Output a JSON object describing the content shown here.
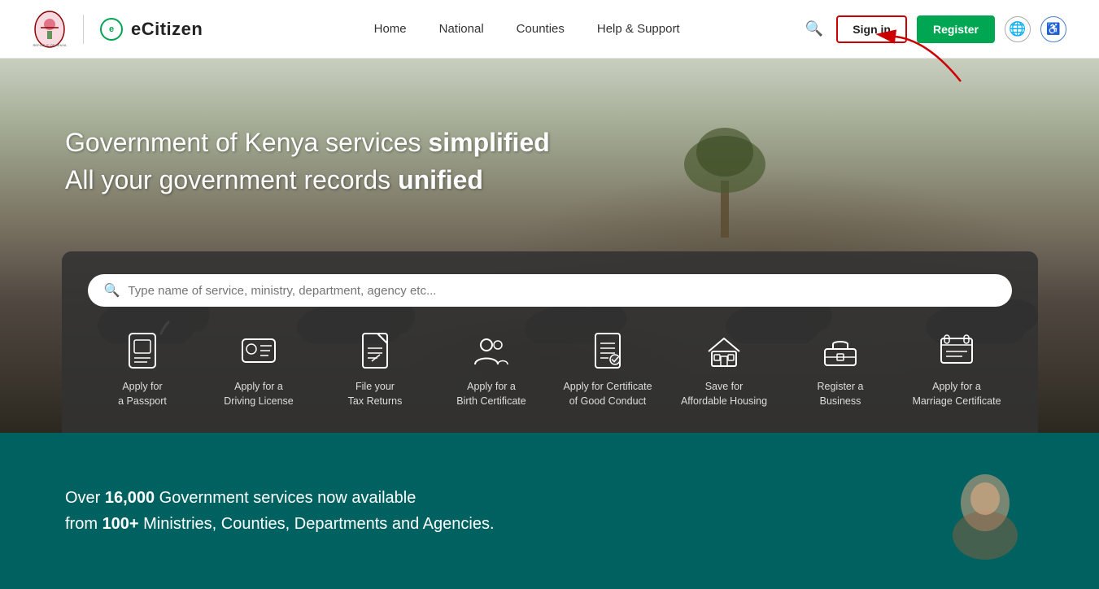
{
  "navbar": {
    "logo_text": "eCitizen",
    "nav_links": [
      {
        "label": "Home",
        "id": "nav-home"
      },
      {
        "label": "National",
        "id": "nav-national"
      },
      {
        "label": "Counties",
        "id": "nav-counties"
      },
      {
        "label": "Help & Support",
        "id": "nav-help"
      }
    ],
    "signin_label": "Sign in",
    "register_label": "Register",
    "search_placeholder": "Type name of service, ministry, department, agency etc..."
  },
  "hero": {
    "headline_part1": "Government of Kenya services ",
    "headline_bold1": "simplified",
    "headline_part2": "All your government records ",
    "headline_bold2": "unified"
  },
  "services": [
    {
      "id": "passport",
      "label": "Apply for\na Passport",
      "icon": "passport"
    },
    {
      "id": "driving",
      "label": "Apply for a\nDriving License",
      "icon": "id-card"
    },
    {
      "id": "tax",
      "label": "File your\nTax Returns",
      "icon": "receipt"
    },
    {
      "id": "birth",
      "label": "Apply for a\nBirth Certificate",
      "icon": "users"
    },
    {
      "id": "conduct",
      "label": "Apply for Certificate\nof Good Conduct",
      "icon": "clipboard"
    },
    {
      "id": "housing",
      "label": "Save for\nAffordable Housing",
      "icon": "home"
    },
    {
      "id": "business",
      "label": "Register a\nBusiness",
      "icon": "briefcase"
    },
    {
      "id": "marriage",
      "label": "Apply for a\nMarriage Certificate",
      "icon": "certificate"
    }
  ],
  "bottom": {
    "text_part1": "Over ",
    "bold1": "16,000",
    "text_part2": " Government services now available\nfrom ",
    "bold2": "100+",
    "text_part3": " Ministries, Counties, Departments\nand Agencies."
  }
}
